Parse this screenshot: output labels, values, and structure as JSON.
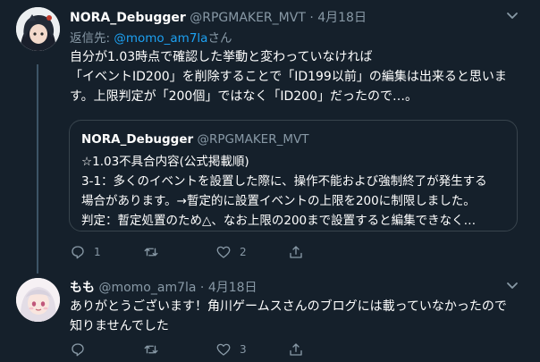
{
  "tweets": [
    {
      "author_name": "NORA_Debugger",
      "handle": "@RPGMAKER_MVT",
      "separator": "·",
      "date": "4月18日",
      "reply_to_prefix": "返信先: ",
      "reply_to_handle": "@momo_am7la",
      "reply_to_suffix": "さん",
      "body_lines": [
        "自分が1.03時点で確認した挙動と変わっていなければ",
        "「イベントID200」を削除することで「ID199以前」の編集は出来ると思いま",
        "す。上限判定が「200個」ではなく「ID200」だったので…。"
      ],
      "quote": {
        "author_name": "NORA_Debugger",
        "handle": "@RPGMAKER_MVT",
        "lines": [
          "☆1.03不具合内容(公式掲載順)",
          "3-1：多くのイベントを設置した際に、操作不能および強制終了が発生する",
          "場合があります。→暫定的に設置イベントの上限を200に制限しました。",
          "判定：暫定処置のため△、なお上限の200まで設置すると編集できなく…"
        ]
      },
      "actions": {
        "reply_count": "1",
        "retweet_count": "",
        "like_count": "2"
      }
    },
    {
      "author_name": "もも",
      "handle": "@momo_am7la",
      "separator": "·",
      "date": "4月18日",
      "body_lines": [
        "ありがとうございます！角川ゲームスさんのブログには載っていなかったので",
        "知りませんでした"
      ],
      "actions": {
        "reply_count": "",
        "retweet_count": "",
        "like_count": "3"
      }
    }
  ],
  "icons": {
    "reply": "reply-icon",
    "retweet": "retweet-icon",
    "like": "like-icon",
    "share": "share-icon",
    "more": "chevron-down-icon"
  },
  "colors": {
    "background": "#15202b",
    "text": "#ffffff",
    "secondary": "#8899a6",
    "link": "#1da1f2",
    "border": "#38444d",
    "thread_line": "#3d5466"
  }
}
